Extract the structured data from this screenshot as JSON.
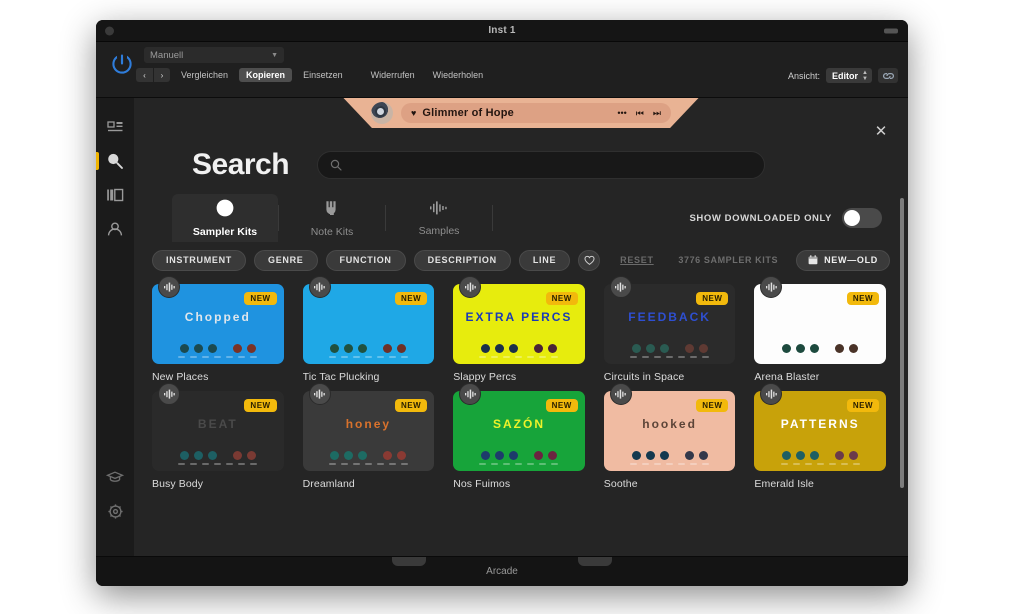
{
  "window": {
    "title": "Inst 1"
  },
  "plugin_header": {
    "preset_value": "Manuell",
    "nav_prev": "‹",
    "nav_next": "›",
    "buttons": [
      "Vergleichen",
      "Kopieren",
      "Einsetzen",
      "Widerrufen",
      "Wiederholen"
    ],
    "active_button": "Kopieren",
    "view_label": "Ansicht:",
    "view_value": "Editor"
  },
  "rail": {
    "items": [
      {
        "name": "browse",
        "icon": "grid-icon",
        "selected": false
      },
      {
        "name": "search",
        "icon": "search-icon",
        "selected": true
      },
      {
        "name": "library",
        "icon": "columns-icon",
        "selected": false
      },
      {
        "name": "account",
        "icon": "person-icon",
        "selected": false
      }
    ],
    "bottom_items": [
      {
        "name": "learn",
        "icon": "graduation-cap-icon"
      },
      {
        "name": "settings",
        "icon": "gear-icon"
      }
    ]
  },
  "player": {
    "track_name": "Glimmer of Hope",
    "favorite_icon": "heart-icon",
    "more_icon": "ellipsis-icon",
    "prev_icon": "skip-back-icon",
    "next_icon": "skip-forward-icon"
  },
  "close_label": "✕",
  "search": {
    "title": "Search",
    "placeholder": "",
    "value": "",
    "icon": "search-icon"
  },
  "tabs": [
    {
      "label": "Sampler Kits",
      "icon": "sampler-kit-icon",
      "active": true
    },
    {
      "label": "Note Kits",
      "icon": "note-kit-icon",
      "active": false
    },
    {
      "label": "Samples",
      "icon": "waveform-icon",
      "active": false
    }
  ],
  "downloaded_toggle": {
    "label": "SHOW DOWNLOADED ONLY",
    "on": false
  },
  "filters": {
    "chips": [
      "INSTRUMENT",
      "GENRE",
      "FUNCTION",
      "DESCRIPTION",
      "LINE"
    ],
    "favorite_icon": "heart-outline-icon",
    "reset_label": "RESET",
    "count_label": "3776 SAMPLER KITS",
    "sort_label": "NEW—OLD",
    "sort_icon": "calendar-icon"
  },
  "kits": [
    {
      "title": "New Places",
      "badge": "NEW",
      "bg": "#1f93e0",
      "art_text": "Chopped",
      "art_text_color": "#dfe6ec",
      "pad_on": "#1b4a4f",
      "pad_off": "#7a3226"
    },
    {
      "title": "Tic Tac Plucking",
      "badge": "NEW",
      "bg": "#1fa8e6",
      "art_text": "",
      "art_text_color": "#ffffff",
      "pad_on": "#20513f",
      "pad_off": "#6e3027"
    },
    {
      "title": "Slappy Percs",
      "badge": "NEW",
      "bg": "#e7ec0d",
      "art_text": "EXTRA PERCS",
      "art_text_color": "#1b3bb5",
      "pad_on": "#1a2f4a",
      "pad_off": "#4a2336"
    },
    {
      "title": "Circuits in Space",
      "badge": "NEW",
      "bg": "#2b2b2b",
      "art_text": "FEEDBACK",
      "art_text_color": "#2e4fd1",
      "pad_on": "#2a5b52",
      "pad_off": "#5f3a33"
    },
    {
      "title": "Arena Blaster",
      "badge": "NEW",
      "bg": "#fdfdfd",
      "art_text": "",
      "art_text_color": "#24307a",
      "pad_on": "#1d4a3e",
      "pad_off": "#4a3328"
    },
    {
      "title": "Busy Body",
      "badge": "NEW",
      "bg": "#2a2a2a",
      "art_text": "BEAT",
      "art_text_color": "#4a4a4a",
      "pad_on": "#1d5f63",
      "pad_off": "#7a3a33"
    },
    {
      "title": "Dreamland",
      "badge": "NEW",
      "bg": "#3a3a3a",
      "art_text": "honey",
      "art_text_color": "#d9722c",
      "pad_on": "#1d6b63",
      "pad_off": "#8a3a33"
    },
    {
      "title": "Nos Fuimos",
      "badge": "NEW",
      "bg": "#17a43a",
      "art_text": "SAZÓN",
      "art_text_color": "#eef22a",
      "pad_on": "#1d3b6b",
      "pad_off": "#6b2340"
    },
    {
      "title": "Soothe",
      "badge": "NEW",
      "bg": "#f0bba2",
      "art_text": "hooked",
      "art_text_color": "#5c4438",
      "pad_on": "#15394f",
      "pad_off": "#33384a"
    },
    {
      "title": "Emerald Isle",
      "badge": "NEW",
      "bg": "#c8a20a",
      "art_text": "PATTERNS",
      "art_text_color": "#ffffff",
      "pad_on": "#1d5f63",
      "pad_off": "#6b3a4a"
    }
  ],
  "bottom_bar": {
    "label": "Arcade"
  }
}
